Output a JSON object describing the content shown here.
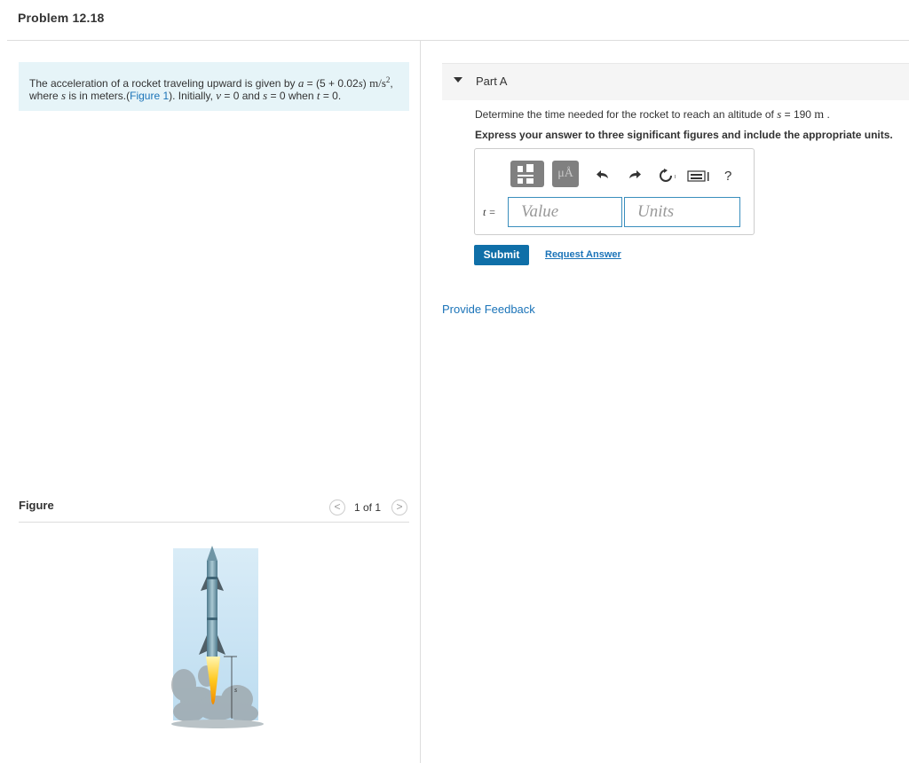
{
  "header": {
    "title": "Problem 12.18"
  },
  "problem": {
    "t1": "The acceleration of a rocket traveling upward is given by ",
    "a_var": "a",
    "t2": " = (5 + 0.02",
    "s_var": "s",
    "t3": ") ",
    "unit": "m/s",
    "unit_exp": "2",
    "t4": ",",
    "t5": "where ",
    "t6": " is in meters.(",
    "figure_link": "Figure 1",
    "t7": "). Initially, ",
    "v_var": "v",
    "t8": " = 0 and ",
    "t9": " = 0 when ",
    "t_var": "t",
    "t10": " = 0."
  },
  "figure": {
    "label": "Figure",
    "prev": "<",
    "next": ">",
    "counter": "1 of 1",
    "dim_label": "s"
  },
  "part_a": {
    "title": "Part A",
    "q_prefix": "Determine the time needed for the rocket to reach an altitude of ",
    "q_var": "s",
    "q_eq": " = 190 ",
    "q_unit": "m",
    "q_suffix": " .",
    "instruction": "Express your answer to three significant figures and include the appropriate units."
  },
  "toolbar": {
    "templates_icon": "templates-icon",
    "units_label": "μÅ",
    "undo_icon": "undo-icon",
    "redo_icon": "redo-icon",
    "reset_icon": "reset-icon",
    "keyboard_icon": "keyboard-icon",
    "help_label": "?"
  },
  "answer": {
    "label": "t =",
    "value_placeholder": "Value",
    "units_placeholder": "Units"
  },
  "actions": {
    "submit": "Submit",
    "request": "Request Answer",
    "feedback": "Provide Feedback"
  }
}
